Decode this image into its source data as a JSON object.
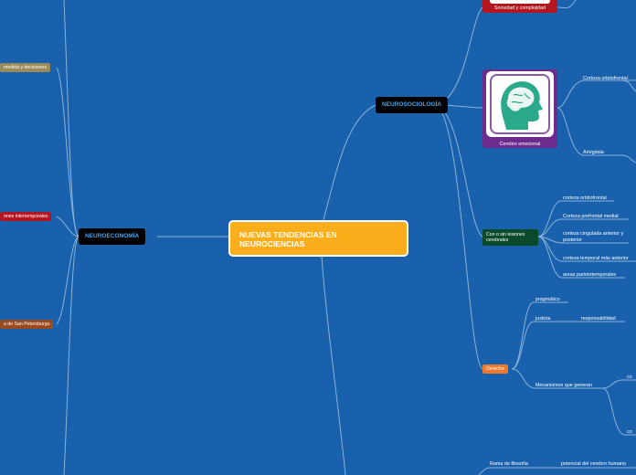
{
  "central": {
    "title": "NUEVAS TENDENCIAS EN NEUROCIENCIAS"
  },
  "neuroeconomia": {
    "label": "NEUROECONOMÍA",
    "children": [
      {
        "label": "medida y decisiones",
        "color": "#9b8a5a"
      },
      {
        "label": "ones intertemporales",
        "color": "#b3161f"
      },
      {
        "label": "a de San Petersburgo",
        "color": "#9b4a1e"
      }
    ]
  },
  "neurosociologia": {
    "label": "NEUROSOCIOLOGÍA",
    "sociedad": "Sociedad y complejidad",
    "cerebro_emocional": {
      "caption": "Cerebro emocional",
      "children": [
        "Corteza orbitofrontal",
        "Amígdala"
      ]
    },
    "lesiones": {
      "label": "Con o sin lesiones cerebrales",
      "color": "#0a4a2a",
      "children": [
        "corteza orbitofrontal",
        "Corteza prefrontal medial",
        "corteza cingulada anterior y posterior",
        "corteza temporal más anterior",
        "areas parietotemporales"
      ]
    },
    "derecho": {
      "label": "Derecho",
      "color": "#f07a2c",
      "children": {
        "pragmatico": "pragmático",
        "justicia": "justicia",
        "responsabilidad": "responsabilidad",
        "mecanismos": "Mecanismos que generan",
        "c1": "co",
        "c2": "co"
      }
    }
  },
  "bottom": {
    "rama": "Rama de filosofía",
    "potencial": "potencial del cerebro humano"
  },
  "colors": {
    "background": "#1961ac",
    "central": "#fbae1c",
    "branch": "#8bb3d8"
  }
}
